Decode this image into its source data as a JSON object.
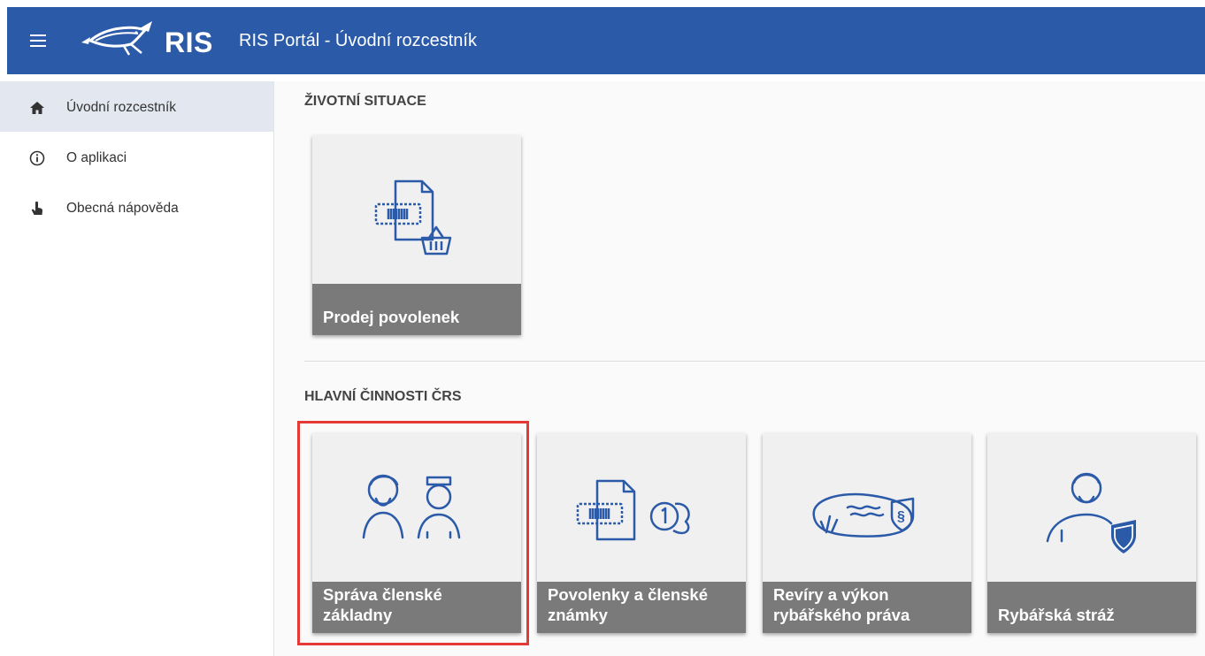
{
  "header": {
    "logo_text": "RIS",
    "title": "RIS Portál - Úvodní rozcestník",
    "menu_icon": "hamburger-icon",
    "logo_icon": "fish-logo-icon"
  },
  "sidebar": {
    "items": [
      {
        "label": "Úvodní rozcestník",
        "icon": "home-icon",
        "active": true
      },
      {
        "label": "O aplikaci",
        "icon": "info-icon",
        "active": false
      },
      {
        "label": "Obecná nápověda",
        "icon": "help-hand-icon",
        "active": false
      }
    ]
  },
  "main": {
    "sections": [
      {
        "title": "ŽIVOTNÍ SITUACE",
        "tiles": [
          {
            "label": "Prodej povolenek",
            "icon": "permit-basket-icon"
          }
        ]
      },
      {
        "title": "HLAVNÍ ČINNOSTI ČRS",
        "tiles": [
          {
            "label": "Správa členské základny",
            "icon": "members-icon",
            "highlighted": true
          },
          {
            "label": "Povolenky a členské známky",
            "icon": "permit-coins-icon"
          },
          {
            "label": "Revíry a výkon rybářského práva",
            "icon": "fishing-ground-law-icon"
          },
          {
            "label": "Rybářská stráž",
            "icon": "guard-shield-icon"
          }
        ]
      }
    ]
  },
  "colors": {
    "appbar": "#2b5aa9",
    "tile_caption": "#7a7a7a",
    "icon_stroke": "#2b5aa9",
    "highlight": "#e53935"
  }
}
